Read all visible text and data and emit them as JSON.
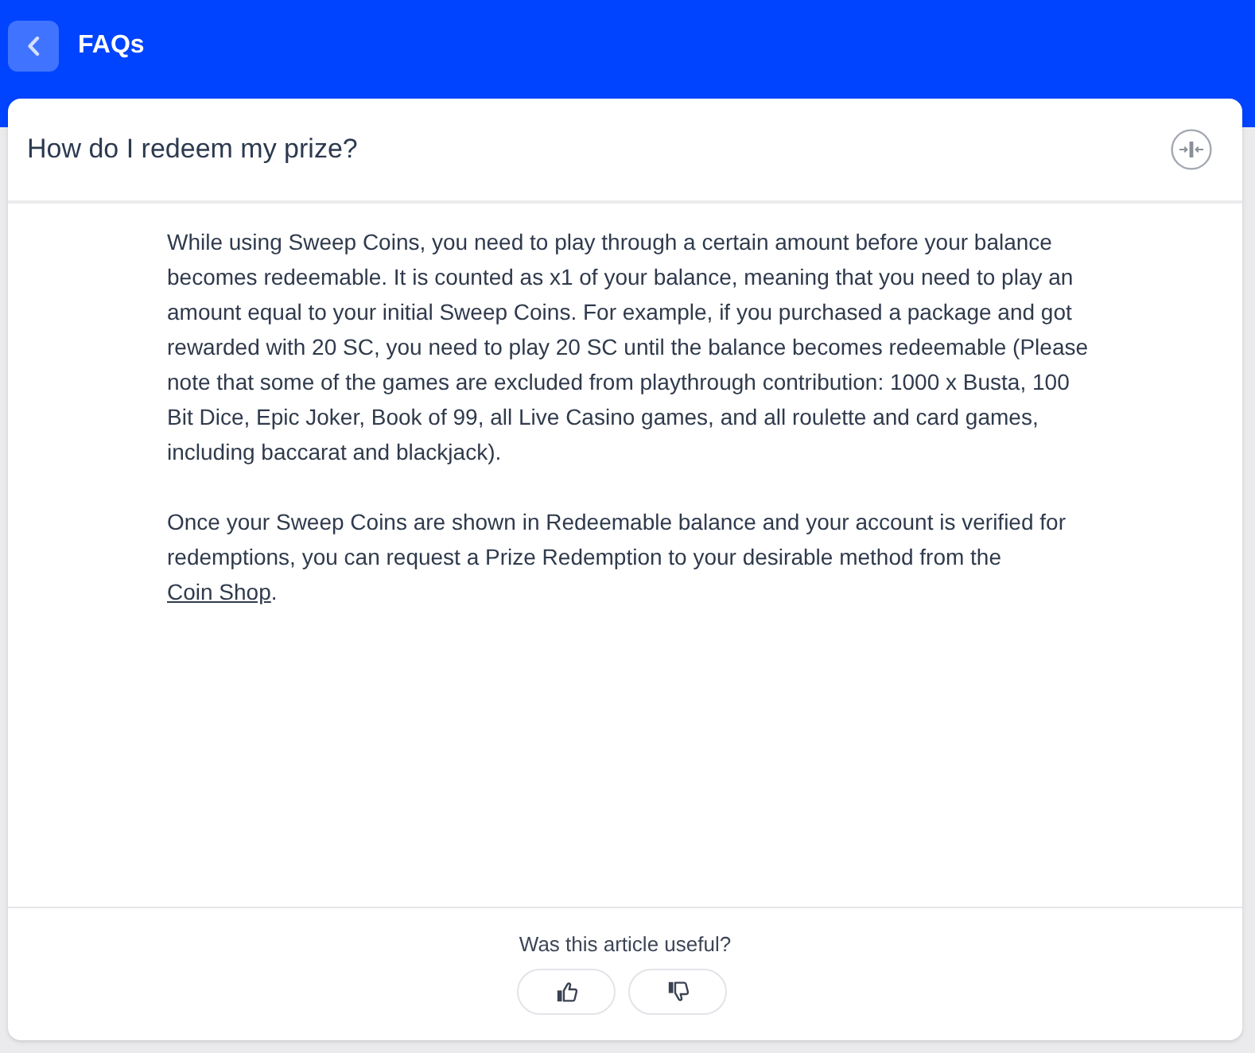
{
  "header": {
    "title": "FAQs"
  },
  "faq": {
    "question": "How do I redeem my prize?",
    "expanded": true,
    "answer": [
      [
        {
          "kind": "text",
          "text": "While using Sweep Coins, you need to play through a certain amount before your balance becomes redeemable. It is counted as x1 of your balance, meaning that you need to play an amount equal to your initial Sweep Coins. For example, if you purchased a package and got rewarded with 20 SC, you need to play 20 SC until the balance becomes redeemable (Please note that some of the games are excluded from playthrough contribution: 1000 x Busta, 100 Bit Dice, Epic Joker, Book of 99, all Live Casino games, and all roulette and card games, including baccarat and blackjack)."
        }
      ],
      [
        {
          "kind": "text",
          "text": "Once your Sweep Coins are shown in Redeemable balance and your account is verified for redemptions, you can request a Prize Redemption to your desirable method from the "
        },
        {
          "kind": "link",
          "text": "Coin Shop"
        },
        {
          "kind": "text",
          "text": "."
        }
      ]
    ]
  },
  "feedback": {
    "prompt": "Was this article useful?"
  }
}
